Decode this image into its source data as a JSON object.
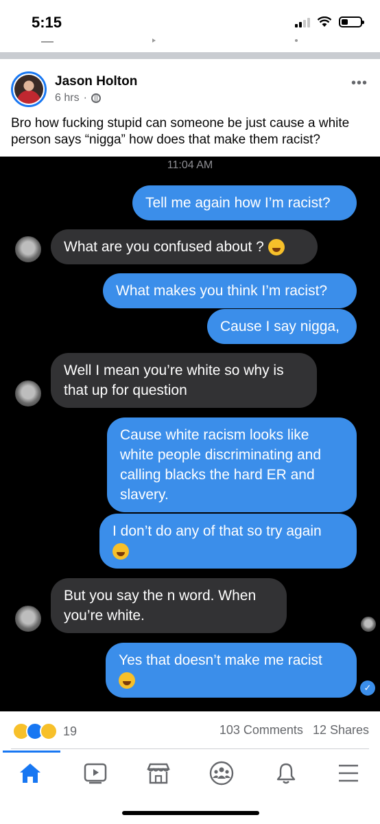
{
  "status": {
    "time": "5:15"
  },
  "post": {
    "author": "Jason Holton",
    "age": "6 hrs",
    "meta_sep": "·",
    "text": "Bro how fucking stupid can someone be just cause a white person says “nigga” how does that make them racist?",
    "more_icon": "•••"
  },
  "chat": {
    "timestamp": "11:04 AM",
    "messages": [
      {
        "dir": "out",
        "text": "Tell me again how I’m racist?"
      },
      {
        "dir": "in",
        "text": "What are you confused about ?"
      },
      {
        "dir": "out",
        "text": "What makes you think I’m racist?"
      },
      {
        "dir": "out",
        "text": "Cause I say nigga,"
      },
      {
        "dir": "in",
        "text": "Well I mean you’re white so why is that up for question"
      },
      {
        "dir": "out",
        "text": "Cause white racism looks like white people discriminating and calling blacks the hard ER and slavery."
      },
      {
        "dir": "out",
        "text": "I don’t do any of that so try again"
      },
      {
        "dir": "in",
        "text": "But you say the n word. When you’re white."
      },
      {
        "dir": "out",
        "text": "Yes that doesn’t make me racist"
      }
    ]
  },
  "footer": {
    "reaction_count": "19",
    "comments": "103 Comments",
    "shares": "12 Shares"
  },
  "tabs": [
    "home-icon",
    "watch-icon",
    "marketplace-icon",
    "groups-icon",
    "notifications-icon",
    "menu-icon"
  ],
  "colors": {
    "accent": "#1877f2",
    "bubble_out": "#3b8eea",
    "bubble_in": "#323234"
  }
}
